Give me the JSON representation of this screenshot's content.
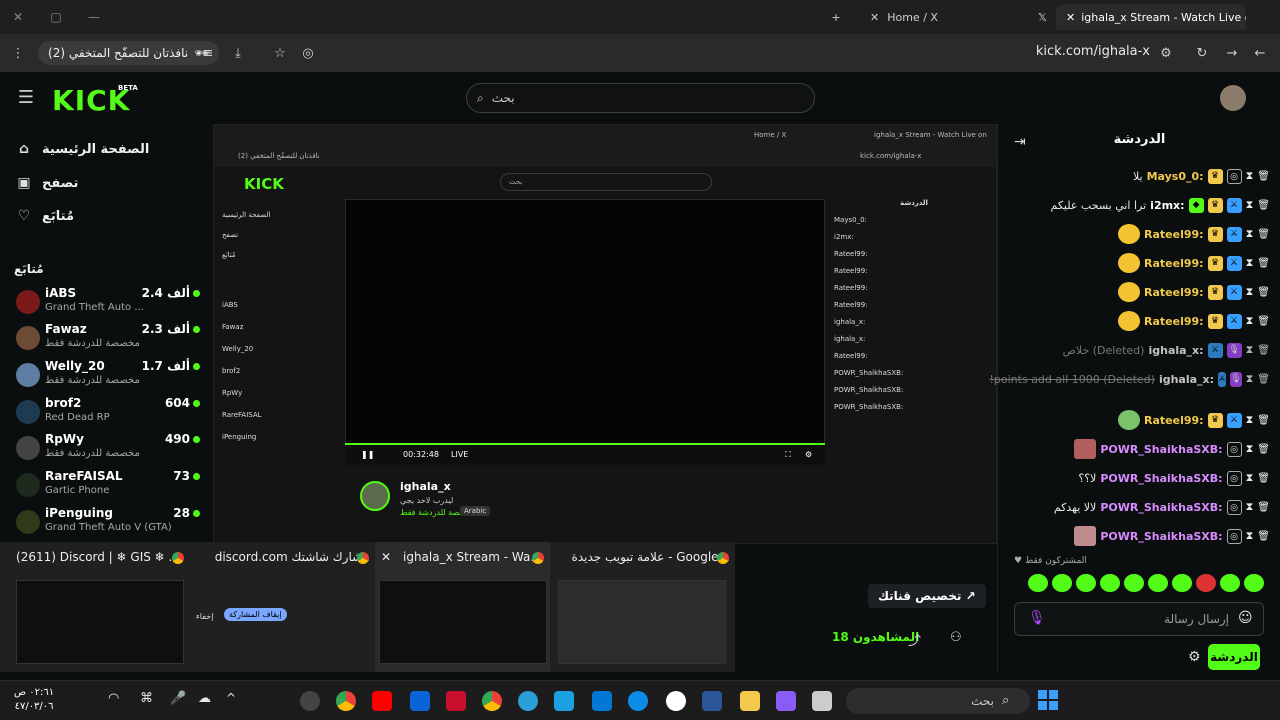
{
  "browser": {
    "tabs": [
      {
        "label": "ighala_x Stream - Watch Live on"
      },
      {
        "label": "Home / X"
      }
    ],
    "incognito_label": "نافذتان للتصفّح المتخفي (2)",
    "url": "kick.com/ighala-x"
  },
  "kick": {
    "logo": "KICK",
    "beta": "BETA",
    "search_placeholder": "بحث",
    "nav": [
      {
        "label": "الصفحة الرئيسية",
        "icon": "home-icon"
      },
      {
        "label": "تصفح",
        "icon": "browse-icon"
      },
      {
        "label": "مُتابَع",
        "icon": "heart-icon"
      }
    ],
    "following_heading": "مُتابَع",
    "following": [
      {
        "name": "iABS",
        "sub": "Grand Theft Auto ...",
        "count": "2.4 ألف"
      },
      {
        "name": "Fawaz",
        "sub": "مخصصة للدردشة فقط",
        "count": "2.3 ألف"
      },
      {
        "name": "Welly_20",
        "sub": "مخصصة للدردشة فقط",
        "count": "1.7 ألف"
      },
      {
        "name": "brof2",
        "sub": "Red Dead RP",
        "count": "604"
      },
      {
        "name": "RpWy",
        "sub": "مخصصة للدردشة فقط",
        "count": "490"
      },
      {
        "name": "RareFAISAL",
        "sub": "Gartic Phone",
        "count": "73"
      },
      {
        "name": "iPenguing",
        "sub": "Grand Theft Auto V (GTA)",
        "count": "28"
      }
    ]
  },
  "stream_capture": {
    "time": "00:32:48",
    "live": "LIVE",
    "streamer": "ighala_x",
    "subtitle": "ليدرب لاحد يجي",
    "category": "مخصصة للدردشة فقط",
    "tag": "Arabic"
  },
  "previews": [
    {
      "title": "(2611) Discord | ❄ GIS ❄ ..."
    },
    {
      "title": "discord.com يشارك شاشتك."
    },
    {
      "title": "ighala_x Stream - Wa..."
    },
    {
      "title": "علامة تبويب جديدة - Google..."
    }
  ],
  "discord_share": {
    "stop": "إيقاف المشاركة",
    "hide": "إخفاء"
  },
  "chat": {
    "title": "الدردشة",
    "messages": [
      {
        "user": "Mays0_0:",
        "text": "يلا",
        "color": "#f2c94c"
      },
      {
        "user": "i2mx:",
        "text": "ترا اني بسحب عليكم",
        "color": "#ffffff"
      },
      {
        "user": "Rateel99:",
        "text": "",
        "color": "#f2c94c"
      },
      {
        "user": "Rateel99:",
        "text": "",
        "color": "#f2c94c"
      },
      {
        "user": "Rateel99:",
        "text": "",
        "color": "#f2c94c"
      },
      {
        "user": "Rateel99:",
        "text": "",
        "color": "#f2c94c"
      },
      {
        "user": "ighala_x:",
        "text": "خلاص (Deleted)",
        "color": "#ffffff"
      },
      {
        "user": "ighala_x:",
        "text": "!points add all 1000 (Deleted)",
        "color": "#ffffff"
      },
      {
        "user": "Rateel99:",
        "text": "",
        "color": "#f2c94c"
      },
      {
        "user": "POWR_ShaikhaSXB:",
        "text": "",
        "color": "#d98cff"
      },
      {
        "user": "POWR_ShaikhaSXB:",
        "text": "لا؟؟",
        "color": "#d98cff"
      },
      {
        "user": "POWR_ShaikhaSXB:",
        "text": "لالا يهدكم",
        "color": "#d98cff"
      },
      {
        "user": "POWR_ShaikhaSXB:",
        "text": "",
        "color": "#d98cff"
      }
    ],
    "subscribers_only": "المشتركون فقط",
    "input_placeholder": "إرسال رسالة",
    "send_label": "الدردشة",
    "customize_label": "تخصيص قناتك",
    "viewers_label": "المشاهدون 18"
  },
  "taskbar": {
    "search": "بحث",
    "time": "٠٢:٦١ ص",
    "date": "٤٧/٠٣/٠٦"
  }
}
